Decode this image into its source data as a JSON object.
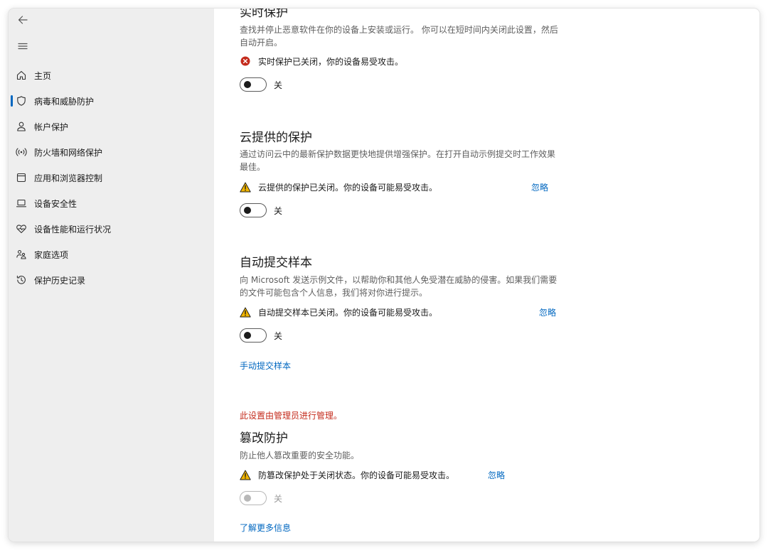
{
  "sidebar": {
    "items": [
      {
        "label": "主页",
        "icon": "home-icon"
      },
      {
        "label": "病毒和威胁防护",
        "icon": "shield-icon",
        "active": true
      },
      {
        "label": "帐户保护",
        "icon": "person-icon"
      },
      {
        "label": "防火墙和网络保护",
        "icon": "wifi-antenna-icon"
      },
      {
        "label": "应用和浏览器控制",
        "icon": "browser-window-icon"
      },
      {
        "label": "设备安全性",
        "icon": "laptop-icon"
      },
      {
        "label": "设备性能和运行状况",
        "icon": "heart-pulse-icon"
      },
      {
        "label": "家庭选项",
        "icon": "family-icon"
      },
      {
        "label": "保护历史记录",
        "icon": "history-icon"
      }
    ]
  },
  "realtime": {
    "title": "实时保护",
    "desc": "查找并停止恶意软件在你的设备上安装或运行。 你可以在短时间内关闭此设置，然后自动开启。",
    "alert": "实时保护已关闭，你的设备易受攻击。",
    "toggle_label": "关"
  },
  "cloud": {
    "title": "云提供的保护",
    "desc": "通过访问云中的最新保护数据更快地提供增强保护。在打开自动示例提交时工作效果最佳。",
    "alert": "云提供的保护已关闭。你的设备可能易受攻击。",
    "ignore": "忽略",
    "toggle_label": "关"
  },
  "sample": {
    "title": "自动提交样本",
    "desc": "向 Microsoft 发送示例文件，以帮助你和其他人免受潜在威胁的侵害。如果我们需要的文件可能包含个人信息，我们将对你进行提示。",
    "alert": "自动提交样本已关闭。你的设备可能易受攻击。",
    "ignore": "忽略",
    "toggle_label": "关",
    "manual_link": "手动提交样本"
  },
  "tamper": {
    "managed": "此设置由管理员进行管理。",
    "title": "篡改防护",
    "desc": "防止他人篡改重要的安全功能。",
    "alert": "防篡改保护处于关闭状态。你的设备可能易受攻击。",
    "ignore": "忽略",
    "toggle_label": "关",
    "learn_more": "了解更多信息"
  },
  "colors": {
    "accent": "#0067c0",
    "error": "#c42b1c",
    "warning": "#f0b400",
    "sidebar_bg": "#eeeeee"
  }
}
